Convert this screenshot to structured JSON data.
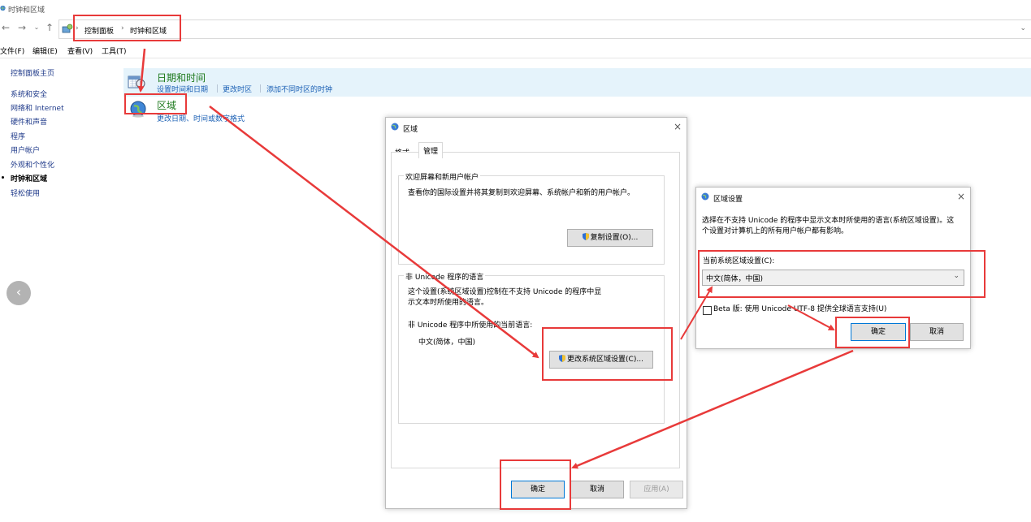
{
  "window": {
    "title": "时钟和区域"
  },
  "address_bar": {
    "breadcrumbs": [
      "控制面板",
      "时钟和区域"
    ],
    "separator": "›"
  },
  "menu": [
    "文件(F)",
    "编辑(E)",
    "查看(V)",
    "工具(T)"
  ],
  "left_nav": {
    "items": [
      {
        "label": "控制面板主页",
        "active": false
      },
      {
        "label": "系统和安全",
        "active": false
      },
      {
        "label": "网络和 Internet",
        "active": false
      },
      {
        "label": "硬件和声音",
        "active": false
      },
      {
        "label": "程序",
        "active": false
      },
      {
        "label": "用户帐户",
        "active": false
      },
      {
        "label": "外观和个性化",
        "active": false
      },
      {
        "label": "时钟和区域",
        "active": true
      },
      {
        "label": "轻松使用",
        "active": false
      }
    ]
  },
  "categories": {
    "datetime": {
      "title": "日期和时间",
      "links": [
        "设置时间和日期",
        "更改时区",
        "添加不同时区的时钟"
      ]
    },
    "region": {
      "title": "区域",
      "links": [
        "更改日期、时间或数字格式"
      ]
    }
  },
  "region_dialog": {
    "title": "区域",
    "tabs": [
      "格式",
      "管理"
    ],
    "active_tab": "管理",
    "welcome_group": {
      "title": "欢迎屏幕和新用户帐户",
      "desc": "查看你的国际设置并将其复制到欢迎屏幕、系统帐户和新的用户帐户。",
      "copy_button": "复制设置(O)..."
    },
    "nonunicode_group": {
      "title": "非 Unicode 程序的语言",
      "desc": "这个设置(系统区域设置)控制在不支持 Unicode 的程序中显示文本时所使用的语言。",
      "current_label": "非 Unicode 程序中所使用的当前语言:",
      "current_value": "中文(简体，中国)",
      "change_button": "更改系统区域设置(C)..."
    },
    "buttons": {
      "ok": "确定",
      "cancel": "取消",
      "apply": "应用(A)"
    }
  },
  "region_settings_dialog": {
    "title": "区域设置",
    "desc_line1": "选择在不支持 Unicode 的程序中显示文本时所使用的语言(系统区域设置)。这",
    "desc_line2": "个设置对计算机上的所有用户帐户都有影响。",
    "current_label": "当前系统区域设置(C):",
    "current_value": "中文(简体，中国)",
    "beta_label": "Beta 版: 使用 Unicode UTF-8 提供全球语言支持(U)",
    "beta_checked": false,
    "buttons": {
      "ok": "确定",
      "cancel": "取消"
    }
  },
  "colors": {
    "annotation": "#e83a3a",
    "link": "#1a5fb4",
    "category_title": "#1e7a1e",
    "band": "#e5f3fb"
  }
}
